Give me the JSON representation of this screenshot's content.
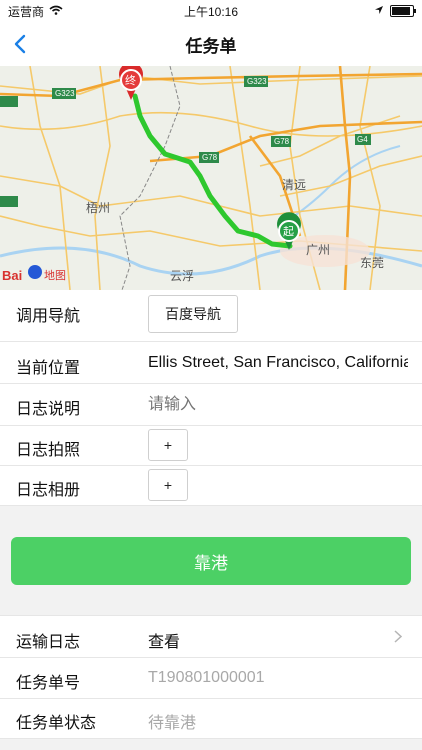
{
  "status_bar": {
    "carrier": "运营商",
    "time": "上午10:16"
  },
  "nav": {
    "title": "任务单",
    "back_icon": "chevron-left-icon"
  },
  "map": {
    "brand": "Bai",
    "brand_suffix": "地图",
    "roads": [
      "G323",
      "G323",
      "G323",
      "G78",
      "G78",
      "G4"
    ],
    "cities": [
      "梧州",
      "清远",
      "广州",
      "东莞",
      "云浮"
    ],
    "start_marker": "起",
    "end_marker": "终",
    "route_color": "#2ec82e"
  },
  "rows": {
    "navigation": {
      "label": "调用导航",
      "button": "百度导航"
    },
    "location": {
      "label": "当前位置",
      "value": "Ellis Street, San Francisco, California"
    },
    "log_note": {
      "label": "日志说明",
      "placeholder": "请输入"
    },
    "log_photo": {
      "label": "日志拍照",
      "button": "+"
    },
    "log_album": {
      "label": "日志相册",
      "button": "+"
    }
  },
  "primary_button": {
    "label": "靠港",
    "color": "#4cd065"
  },
  "details": {
    "transport_log": {
      "label": "运输日志",
      "value": "查看"
    },
    "task_number": {
      "label": "任务单号",
      "value": "T190801000001"
    },
    "task_status": {
      "label": "任务单状态",
      "value": "待靠港"
    }
  }
}
